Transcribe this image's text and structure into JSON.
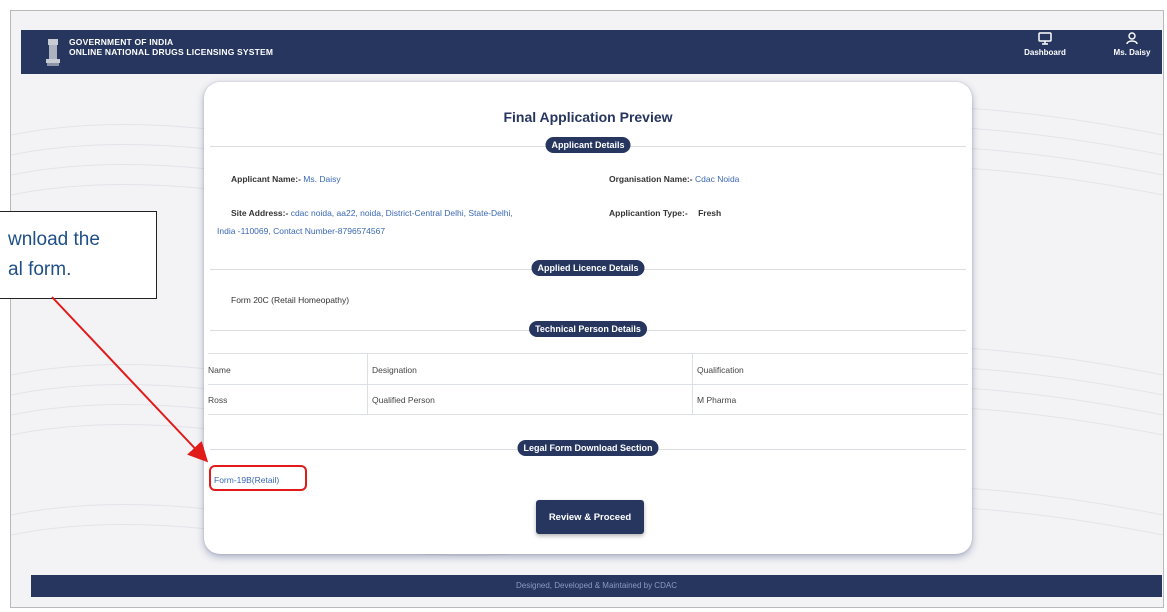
{
  "header": {
    "gov_line1": "GOVERNMENT OF INDIA",
    "gov_line2": "ONLINE NATIONAL DRUGS LICENSING SYSTEM",
    "nav": [
      {
        "label": "Dashboard",
        "icon": "monitor-icon"
      },
      {
        "label": "Ms. Daisy",
        "icon": "user-icon"
      }
    ]
  },
  "card": {
    "title": "Final Application Preview",
    "applicant_section": "Applicant Details",
    "applicant_name_label": "Applicant Name:-",
    "applicant_name_value": "Ms. Daisy",
    "organisation_label": "Organisation Name:-",
    "organisation_value": "Cdac Noida",
    "site_address_label": "Site Address:-",
    "site_address_line1": "cdac noida, aa22, noida, District-Central Delhi, State-Delhi,",
    "site_address_line2": "India -110069, Contact Number-8796574567",
    "application_type_label": "Applicantion Type:-",
    "application_type_value": "Fresh",
    "licence_section": "Applied Licence Details",
    "licence_item": "Form 20C (Retail Homeopathy)",
    "technical_section": "Technical Person Details",
    "table": {
      "headers": [
        "Name",
        "Designation",
        "Qualification"
      ],
      "rows": [
        [
          "Ross",
          "Qualified Person",
          "M Pharma"
        ]
      ]
    },
    "legal_section": "Legal Form Download Section",
    "form_link": "Form-19B(Retail)",
    "proceed_button": "Review & Proceed"
  },
  "footer": {
    "text": "Designed, Developed & Maintained by CDAC"
  },
  "annotation": {
    "line1": "wnload the",
    "line2": "al form.",
    "color": "#e11a1a"
  },
  "colors": {
    "primary": "#27365f",
    "link": "#3b68b5",
    "highlight": "#e11a1a"
  }
}
